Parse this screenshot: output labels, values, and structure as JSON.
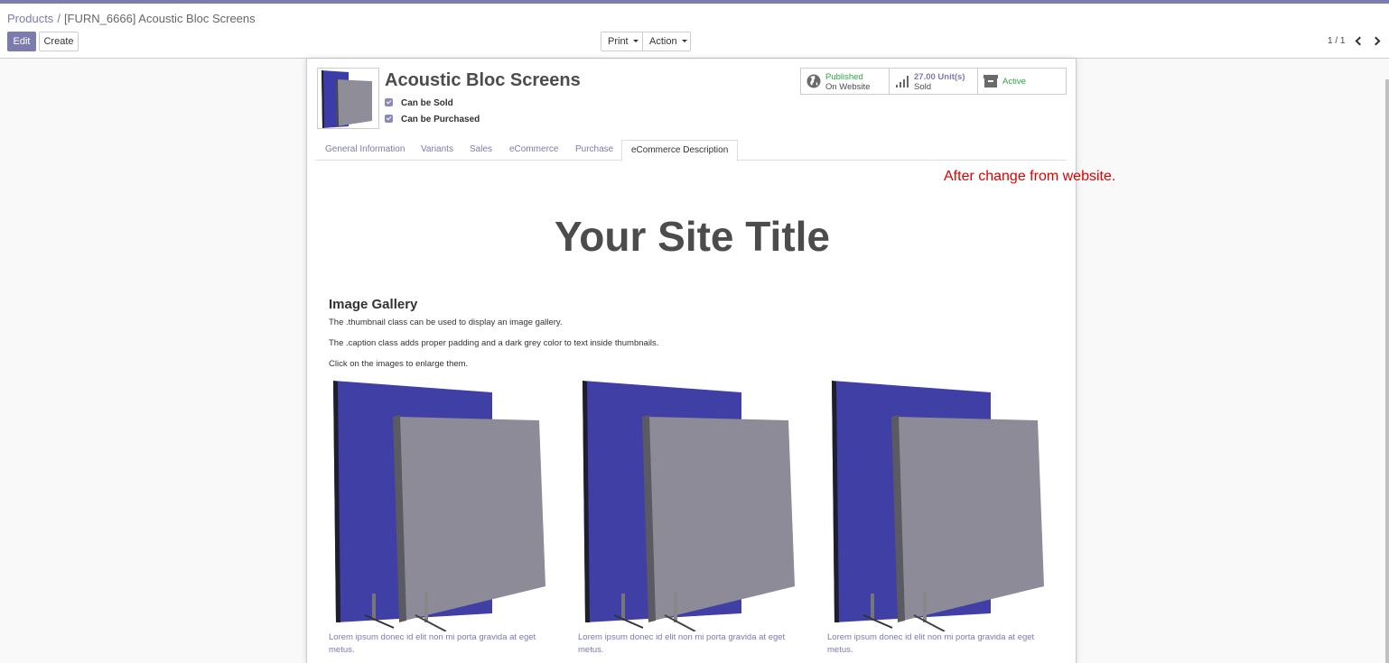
{
  "breadcrumb": {
    "parent": "Products",
    "separator": "/",
    "current": "[FURN_6666] Acoustic Bloc Screens"
  },
  "buttons": {
    "edit": "Edit",
    "create": "Create",
    "print": "Print",
    "action": "Action"
  },
  "pager": {
    "text": "1 / 1"
  },
  "product": {
    "name": "Acoustic Bloc Screens",
    "can_be_sold": "Can be Sold",
    "can_be_purchased": "Can be Purchased"
  },
  "stats": {
    "published": {
      "line1": "Published",
      "line2": "On Website"
    },
    "sold": {
      "line1": "27.00 Unit(s)",
      "line2": "Sold"
    },
    "active": {
      "label": "Active"
    }
  },
  "tabs": [
    {
      "label": "General Information"
    },
    {
      "label": "Variants"
    },
    {
      "label": "Sales"
    },
    {
      "label": "eCommerce"
    },
    {
      "label": "Purchase"
    },
    {
      "label": "eCommerce Description"
    }
  ],
  "annotation": "After change from website.",
  "content": {
    "site_title": "Your Site Title",
    "gallery_heading": "Image Gallery",
    "paragraphs": [
      "The .thumbnail class can be used to display an image gallery.",
      "The .caption class adds proper padding and a dark grey color to text inside thumbnails.",
      "Click on the images to enlarge them."
    ],
    "captions": [
      "Lorem ipsum donec id elit non mi porta gravida at eget metus.",
      "Lorem ipsum donec id elit non mi porta gravida at eget metus.",
      "Lorem ipsum donec id elit non mi porta gravida at eget metus."
    ]
  },
  "colors": {
    "brand": "#7c7bad",
    "annotation_red": "#e00000",
    "status_green": "#28a745",
    "screen_blue": "#3f3fa6",
    "screen_grey": "#8d8b97"
  },
  "icons": {
    "published": "globe-icon",
    "sold": "signal-bars-icon",
    "active": "archive-icon"
  }
}
